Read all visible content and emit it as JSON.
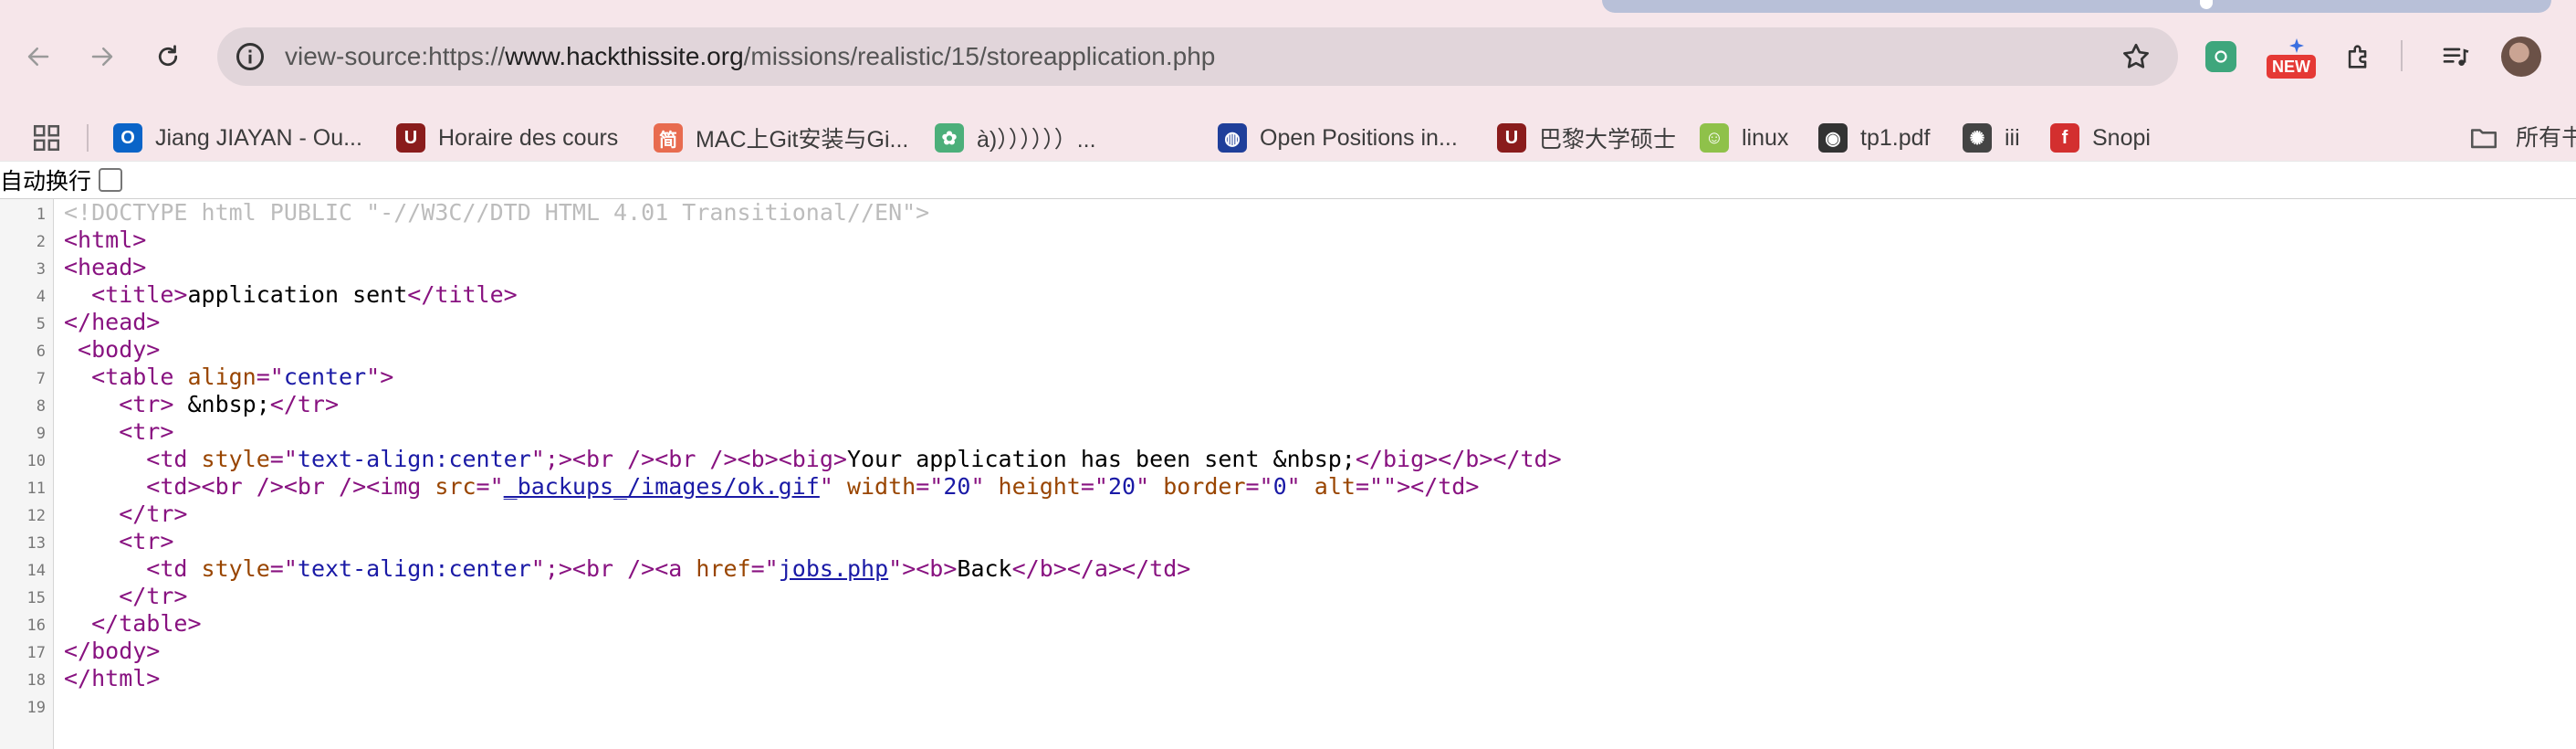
{
  "browser": {
    "url_scheme": "view-source:https://",
    "url_domain": "www.hackthissite.org",
    "url_path": "/missions/realistic/15/storeapplication.php",
    "new_badge": "NEW"
  },
  "bookmarks": [
    {
      "label": "Jiang JIAYAN - Ou...",
      "icon": "outlook-icon",
      "color": "#0a64c8",
      "glyph": "O"
    },
    {
      "label": "Horaire des cours",
      "icon": "university-icon",
      "color": "#8a1c1c",
      "glyph": "U"
    },
    {
      "label": "MAC上Git安装与Gi...",
      "icon": "jianshu-icon",
      "color": "#e86b4f",
      "glyph": "简"
    },
    {
      "label": "à)））））））...",
      "icon": "paw-icon",
      "color": "#4caf7a",
      "glyph": "✿"
    },
    {
      "label": "Open Positions in...",
      "icon": "globe-icon",
      "color": "#1f3f9a",
      "glyph": "◍"
    },
    {
      "label": "巴黎大学硕士",
      "icon": "university-icon",
      "color": "#8a1c1c",
      "glyph": "U"
    },
    {
      "label": "linux",
      "icon": "linux-icon",
      "color": "#8fc14a",
      "glyph": "☺"
    },
    {
      "label": "tp1.pdf",
      "icon": "globe-dark-icon",
      "color": "#333333",
      "glyph": "◉"
    },
    {
      "label": "iii",
      "icon": "openai-icon",
      "color": "#444444",
      "glyph": "✺"
    },
    {
      "label": "Snopi",
      "icon": "snopi-icon",
      "color": "#d32f2f",
      "glyph": "f"
    }
  ],
  "bookmarks_all": "所有书",
  "wrap_label": "自动换行",
  "source": {
    "l1": "<!DOCTYPE html PUBLIC \"-//W3C//DTD HTML 4.01 Transitional//EN\">",
    "l2": "<html>",
    "l3": "<head>",
    "l4a": "  <title>",
    "l4b": "application sent",
    "l4c": "</title>",
    "l5": "</head>",
    "l6": " <body>",
    "l7a": "  <table ",
    "l7b": "align",
    "l7c": "=\"",
    "l7d": "center",
    "l7e": "\">",
    "l8a": "    <tr>",
    "l8b": " &nbsp;",
    "l8c": "</tr>",
    "l9": "    <tr>",
    "l10a": "      <td ",
    "l10b": "style",
    "l10c": "=\"",
    "l10d": "text-align:center",
    "l10e": "\";><br /><br /><b><big>",
    "l10f": "Your application has been sent &nbsp;",
    "l10g": "</big></b></td>",
    "l11a": "      <td><br /><br /><img ",
    "l11b": "src",
    "l11c": "=\"",
    "l11d": "_backups_/images/ok.gif",
    "l11e": "\" ",
    "l11f": "width",
    "l11g": "=\"",
    "l11h": "20",
    "l11i": "\" ",
    "l11j": "height",
    "l11k": "=\"",
    "l11l": "20",
    "l11m": "\" ",
    "l11n": "border",
    "l11o": "=\"",
    "l11p": "0",
    "l11q": "\" ",
    "l11r": "alt",
    "l11s": "=\"\"></td>",
    "l12": "    </tr>",
    "l13": "    <tr>",
    "l14a": "      <td ",
    "l14b": "style",
    "l14c": "=\"",
    "l14d": "text-align:center",
    "l14e": "\";><br /><a ",
    "l14f": "href",
    "l14g": "=\"",
    "l14h": "jobs.php",
    "l14i": "\"><b>",
    "l14j": "Back",
    "l14k": "</b></a></td>",
    "l15": "    </tr>",
    "l16": "  </table>",
    "l17": "</body>",
    "l18": "</html>",
    "l19": ""
  },
  "line_numbers": [
    "1",
    "2",
    "3",
    "4",
    "5",
    "6",
    "7",
    "8",
    "9",
    "10",
    "11",
    "12",
    "13",
    "14",
    "15",
    "16",
    "17",
    "18",
    "19"
  ]
}
